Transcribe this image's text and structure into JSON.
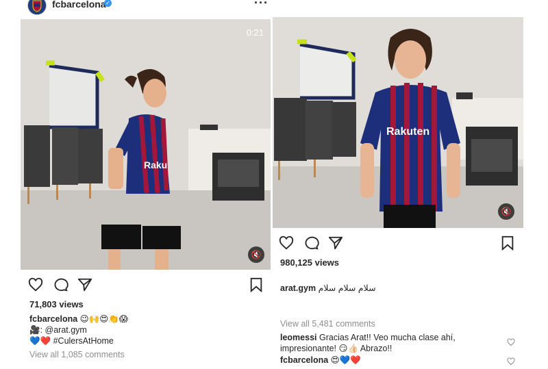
{
  "left_post": {
    "username": "fcbarcelona",
    "timer": "0:21",
    "views": "71,803 views",
    "caption_user": "fcbarcelona",
    "caption_emojis": "😉🙌😍👏😱",
    "credit_line": "🎥: @arat.gym",
    "hashtag_line": "💙❤️ #CulersAtHome",
    "view_comments": "View all 1,085 comments"
  },
  "right_post": {
    "views": "980,125 views",
    "caption_user": "arat.gym",
    "caption_text": "سلام سلام سلام",
    "view_comments": "View all 5,481 comments",
    "comments": [
      {
        "user": "leomessi",
        "text": "Gracias Arat!! Veo mucha clase ahí, impresionante! 😏👍🏻 Abrazo!!"
      },
      {
        "user": "fcbarcelona",
        "text": "😍💙❤️"
      }
    ]
  },
  "colors": {
    "jersey_blue": "#1d2f7a",
    "jersey_red": "#a3173a",
    "link_blue": "#3897f0"
  },
  "icons": [
    "heart-icon",
    "comment-icon",
    "share-icon",
    "bookmark-icon",
    "mute-icon",
    "more-icon",
    "verified-icon"
  ]
}
